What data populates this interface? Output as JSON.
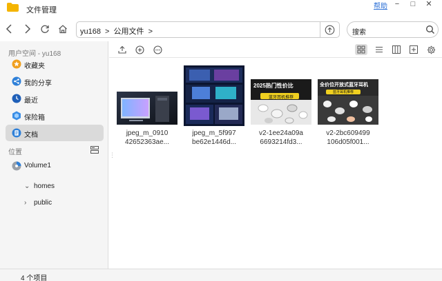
{
  "window": {
    "title": "文件管理",
    "help": "帮助",
    "minimize": "−",
    "maximize": "□",
    "close": "✕"
  },
  "nav": {
    "path_segments": [
      "yu168",
      ">",
      "公用文件",
      ">"
    ],
    "search_placeholder": "搜索"
  },
  "sidebar": {
    "user_header": "用户空间 - yu168",
    "items": [
      {
        "label": "收藏夹",
        "icon": "star-icon"
      },
      {
        "label": "我的分享",
        "icon": "share-icon"
      },
      {
        "label": "最近",
        "icon": "clock-icon"
      },
      {
        "label": "保险箱",
        "icon": "safe-icon"
      },
      {
        "label": "文档",
        "icon": "document-icon"
      }
    ],
    "location_header": "位置",
    "volume": "Volume1",
    "tree": [
      {
        "label": "homes",
        "chevron": "⌄"
      },
      {
        "label": "public",
        "chevron": "›"
      }
    ]
  },
  "files": [
    {
      "name_line1": "jpeg_m_0910",
      "name_line2": "42652363ae...",
      "thumb": "desktop-pc-photo"
    },
    {
      "name_line1": "jpeg_m_5f997",
      "name_line2": "be62e1446d...",
      "thumb": "monitors-collage"
    },
    {
      "name_line1": "v2-1ee24a09a",
      "name_line2": "6693214fd3...",
      "thumb": "earbuds-promo-light"
    },
    {
      "name_line1": "v2-2bc609499",
      "name_line2": "106d05f001...",
      "thumb": "earbuds-promo-dark"
    }
  ],
  "thumb_text": {
    "t3_headline": "2025热门性价比",
    "t3_sub": "蓝牙耳机推荐",
    "t4_headline": "全价位开放式蓝牙耳机",
    "t4_sub": "蓝牙耳机推荐"
  },
  "status": {
    "count": "4 个项目"
  },
  "colors": {
    "accent": "#2a6fd6",
    "selected_bg": "#dadada",
    "sidebar_bg": "#f5f5f5",
    "folder": "#f4b400"
  }
}
